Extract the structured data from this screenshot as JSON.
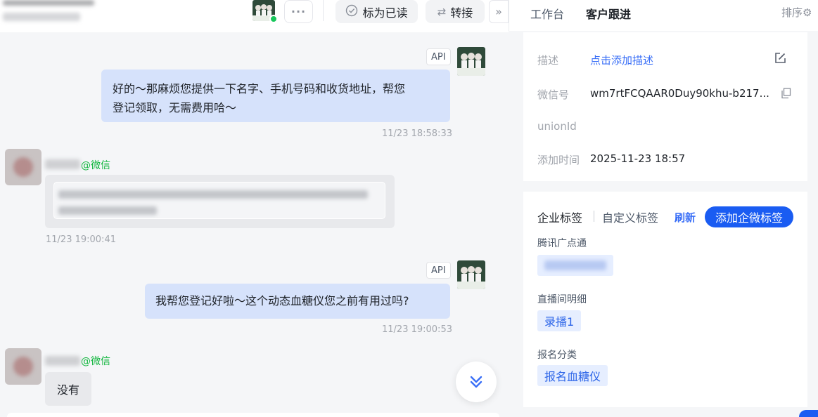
{
  "header": {
    "more_label": "···",
    "mark_read_icon": "check-circle-icon",
    "mark_read_label": "标为已读",
    "transfer_icon": "transfer-arrows-icon",
    "transfer_label": "转接",
    "collapse_label": "»"
  },
  "messages": {
    "out1": {
      "tag": "API",
      "lines": [
        "好的～那麻烦您提供一下名字、手机号码和收货地址，帮您",
        "登记领取，无需费用哈～"
      ],
      "time": "11/23 18:58:33"
    },
    "in1": {
      "channel": "@微信",
      "time": "11/23 19:00:41"
    },
    "out2": {
      "tag": "API",
      "text": "我帮您登记好啦～这个动态血糖仪您之前有用过吗?",
      "time": "11/23 19:00:53"
    },
    "in2": {
      "channel": "@微信",
      "text": "没有"
    }
  },
  "sidebar": {
    "tabs": [
      "工作台",
      "客户跟进"
    ],
    "active_tab": "客户跟进",
    "sort_label": "排序",
    "info": {
      "desc_label": "描述",
      "desc_value": "点击添加描述",
      "wechat_label": "微信号",
      "wechat_value": "wm7rtFCQAAR0Duy90khu-b217...",
      "unionid_label": "unionId",
      "added_label": "添加时间",
      "added_value": "2025-11-23 18:57"
    },
    "tags": {
      "tab_enterprise": "企业标签",
      "tab_custom": "自定义标签",
      "refresh": "刷新",
      "add_button": "添加企微标签",
      "groups": [
        {
          "title": "腾讯广点通",
          "chips": []
        },
        {
          "title": "直播间明细",
          "chips": [
            "录播1"
          ]
        },
        {
          "title": "报名分类",
          "chips": [
            "报名血糖仪"
          ]
        }
      ]
    }
  },
  "colors": {
    "accent": "#1a5cf2",
    "outgoing_bubble": "#d6e2fb",
    "wechat_green": "#13b63f"
  }
}
